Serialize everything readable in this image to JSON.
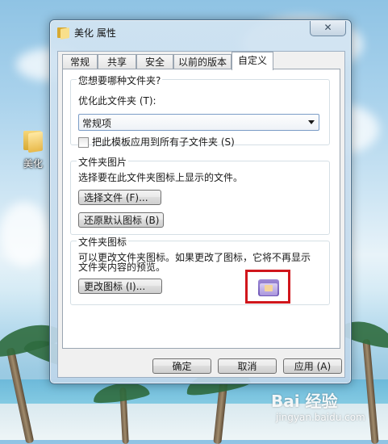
{
  "desktop": {
    "icon_label": "美化"
  },
  "window": {
    "title": "美化 属性",
    "close_glyph": "✕",
    "tabs": [
      {
        "label": "常规"
      },
      {
        "label": "共享"
      },
      {
        "label": "安全"
      },
      {
        "label": "以前的版本"
      },
      {
        "label": "自定义"
      }
    ],
    "active_tab": "自定义",
    "section_folder_type": {
      "title": "您想要哪种文件夹?",
      "optimize_label": "优化此文件夹 (T):",
      "optimize_value": "常规项",
      "apply_subfolders_label": "把此模板应用到所有子文件夹 (S)",
      "apply_subfolders_checked": false
    },
    "section_folder_picture": {
      "title": "文件夹图片",
      "description": "选择要在此文件夹图标上显示的文件。",
      "choose_file_button": "选择文件 (F)...",
      "restore_default_button": "还原默认图标 (B)"
    },
    "section_folder_icon": {
      "title": "文件夹图标",
      "description_line1": "可以更改文件夹图标。如果更改了图标，它将不再显示",
      "description_line2": "文件夹内容的预览。",
      "change_icon_button": "更改图标 (I)..."
    },
    "footer": {
      "ok": "确定",
      "cancel": "取消",
      "apply": "应用 (A)"
    }
  },
  "watermark": {
    "brand": "Bai 经验",
    "url": "jingyan.baidu.com"
  },
  "colors": {
    "highlight_frame": "#d0161c",
    "window_frame": "#c8dbea"
  }
}
